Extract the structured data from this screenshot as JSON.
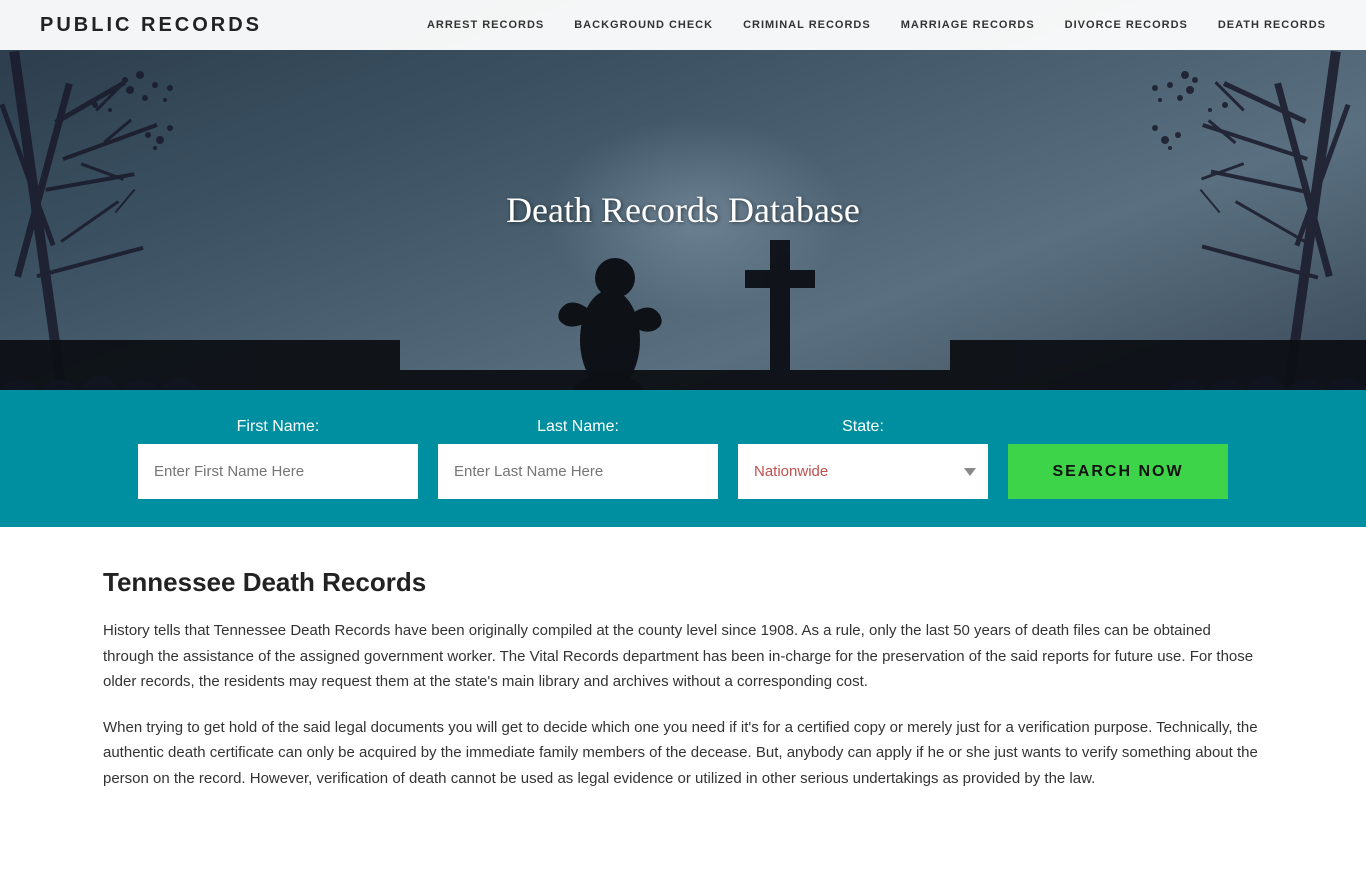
{
  "header": {
    "logo": "PUBLIC RECORDS",
    "nav": [
      {
        "label": "ARREST RECORDS",
        "id": "arrest-records"
      },
      {
        "label": "BACKGROUND CHECK",
        "id": "background-check"
      },
      {
        "label": "CRIMINAL RECORDS",
        "id": "criminal-records"
      },
      {
        "label": "MARRIAGE RECORDS",
        "id": "marriage-records"
      },
      {
        "label": "DIVORCE RECORDS",
        "id": "divorce-records"
      },
      {
        "label": "DEATH RECORDS",
        "id": "death-records"
      }
    ]
  },
  "hero": {
    "title": "Death Records Database"
  },
  "search": {
    "first_name_label": "First Name:",
    "first_name_placeholder": "Enter First Name Here",
    "last_name_label": "Last Name:",
    "last_name_placeholder": "Enter Last Name Here",
    "state_label": "State:",
    "state_value": "Nationwide",
    "button_label": "SEARCH NOW"
  },
  "content": {
    "heading": "Tennessee Death Records",
    "paragraph1": "History tells that Tennessee Death Records have been originally compiled at the county level since 1908. As a rule, only the last 50 years of death files can be obtained through the assistance of the assigned government worker. The Vital Records department has been in-charge for the preservation of the said reports for future use. For those older records, the residents may request them at the state's main library and archives without a corresponding cost.",
    "paragraph2": "When trying to get hold of the said legal documents you will get to decide which one you need if it's for a certified copy or merely just for a verification purpose. Technically, the authentic death certificate can only be acquired by the immediate family members of the decease. But, anybody can apply if he or she just wants to verify something about the person on the record. However, verification of death cannot be used as legal evidence or utilized in other serious undertakings as provided by the law."
  }
}
